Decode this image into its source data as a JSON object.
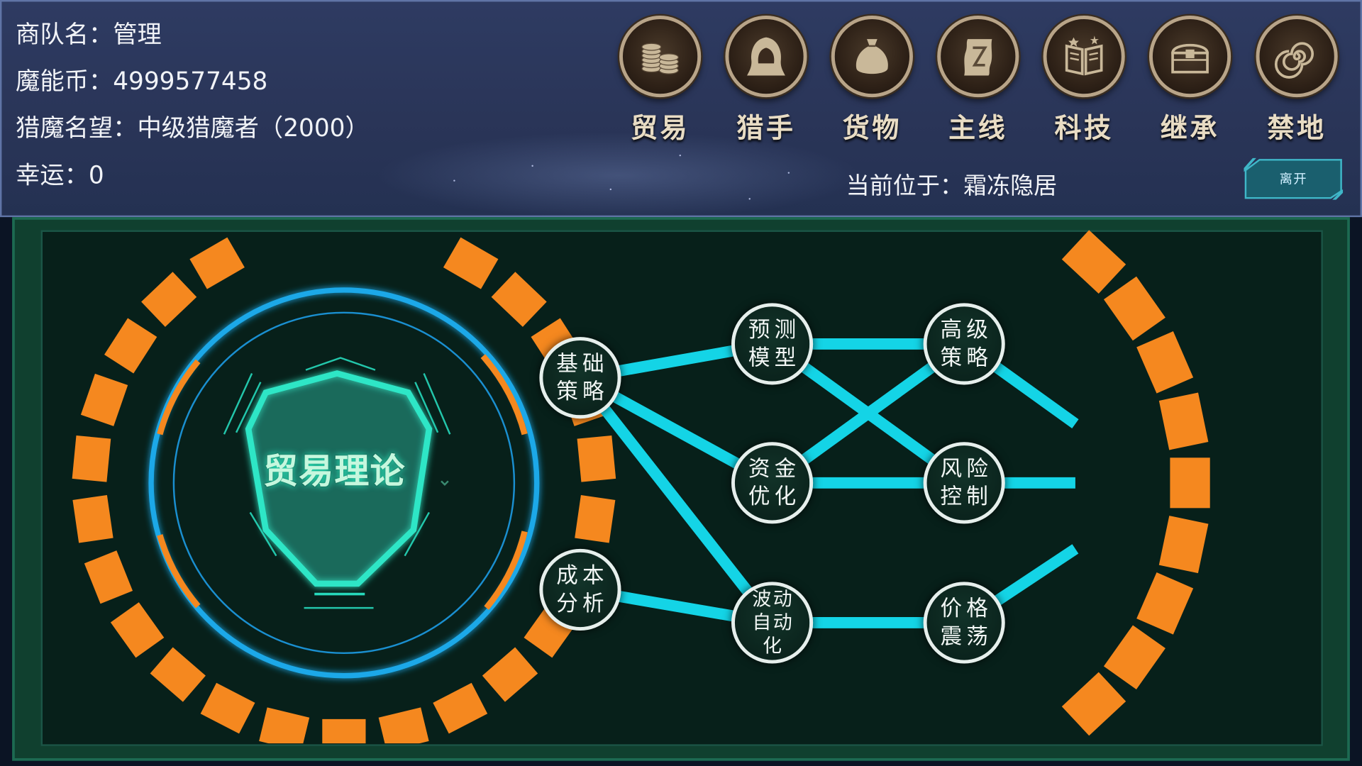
{
  "header": {
    "caravan_label": "商队名：",
    "caravan_value": "管理",
    "coin_label": "魔能币：",
    "coin_value": "4999577458",
    "reputation_label": "猎魔名望：",
    "reputation_value": "中级猎魔者（2000）",
    "luck_label": "幸运：",
    "luck_value": "0",
    "location_label": "当前位于：",
    "location_value": "霜冻隐居",
    "leave_label": "离开"
  },
  "toolbar": [
    {
      "label": "贸易",
      "icon": "coins-icon"
    },
    {
      "label": "猎手",
      "icon": "hood-icon"
    },
    {
      "label": "货物",
      "icon": "sack-icon"
    },
    {
      "label": "主线",
      "icon": "scroll-icon"
    },
    {
      "label": "科技",
      "icon": "book-icon"
    },
    {
      "label": "继承",
      "icon": "chest-icon"
    },
    {
      "label": "禁地",
      "icon": "spiral-icon"
    }
  ],
  "tree": {
    "title": "贸易理论",
    "nodes": [
      {
        "id": "basic",
        "label": "基础策略"
      },
      {
        "id": "cost",
        "label": "成本分析"
      },
      {
        "id": "forecast",
        "label": "预测模型"
      },
      {
        "id": "funds",
        "label": "资金优化"
      },
      {
        "id": "volatility",
        "label": "波动自动化"
      },
      {
        "id": "advanced",
        "label": "高级策略"
      },
      {
        "id": "risk",
        "label": "风险控制"
      },
      {
        "id": "price",
        "label": "价格震荡"
      }
    ]
  },
  "colors": {
    "accent_orange": "#f5881f",
    "link_cyan": "#14d4e6",
    "ring_blue": "#1ca8e8",
    "shield_teal": "#27d9bb",
    "board_bg": "#07201a"
  }
}
